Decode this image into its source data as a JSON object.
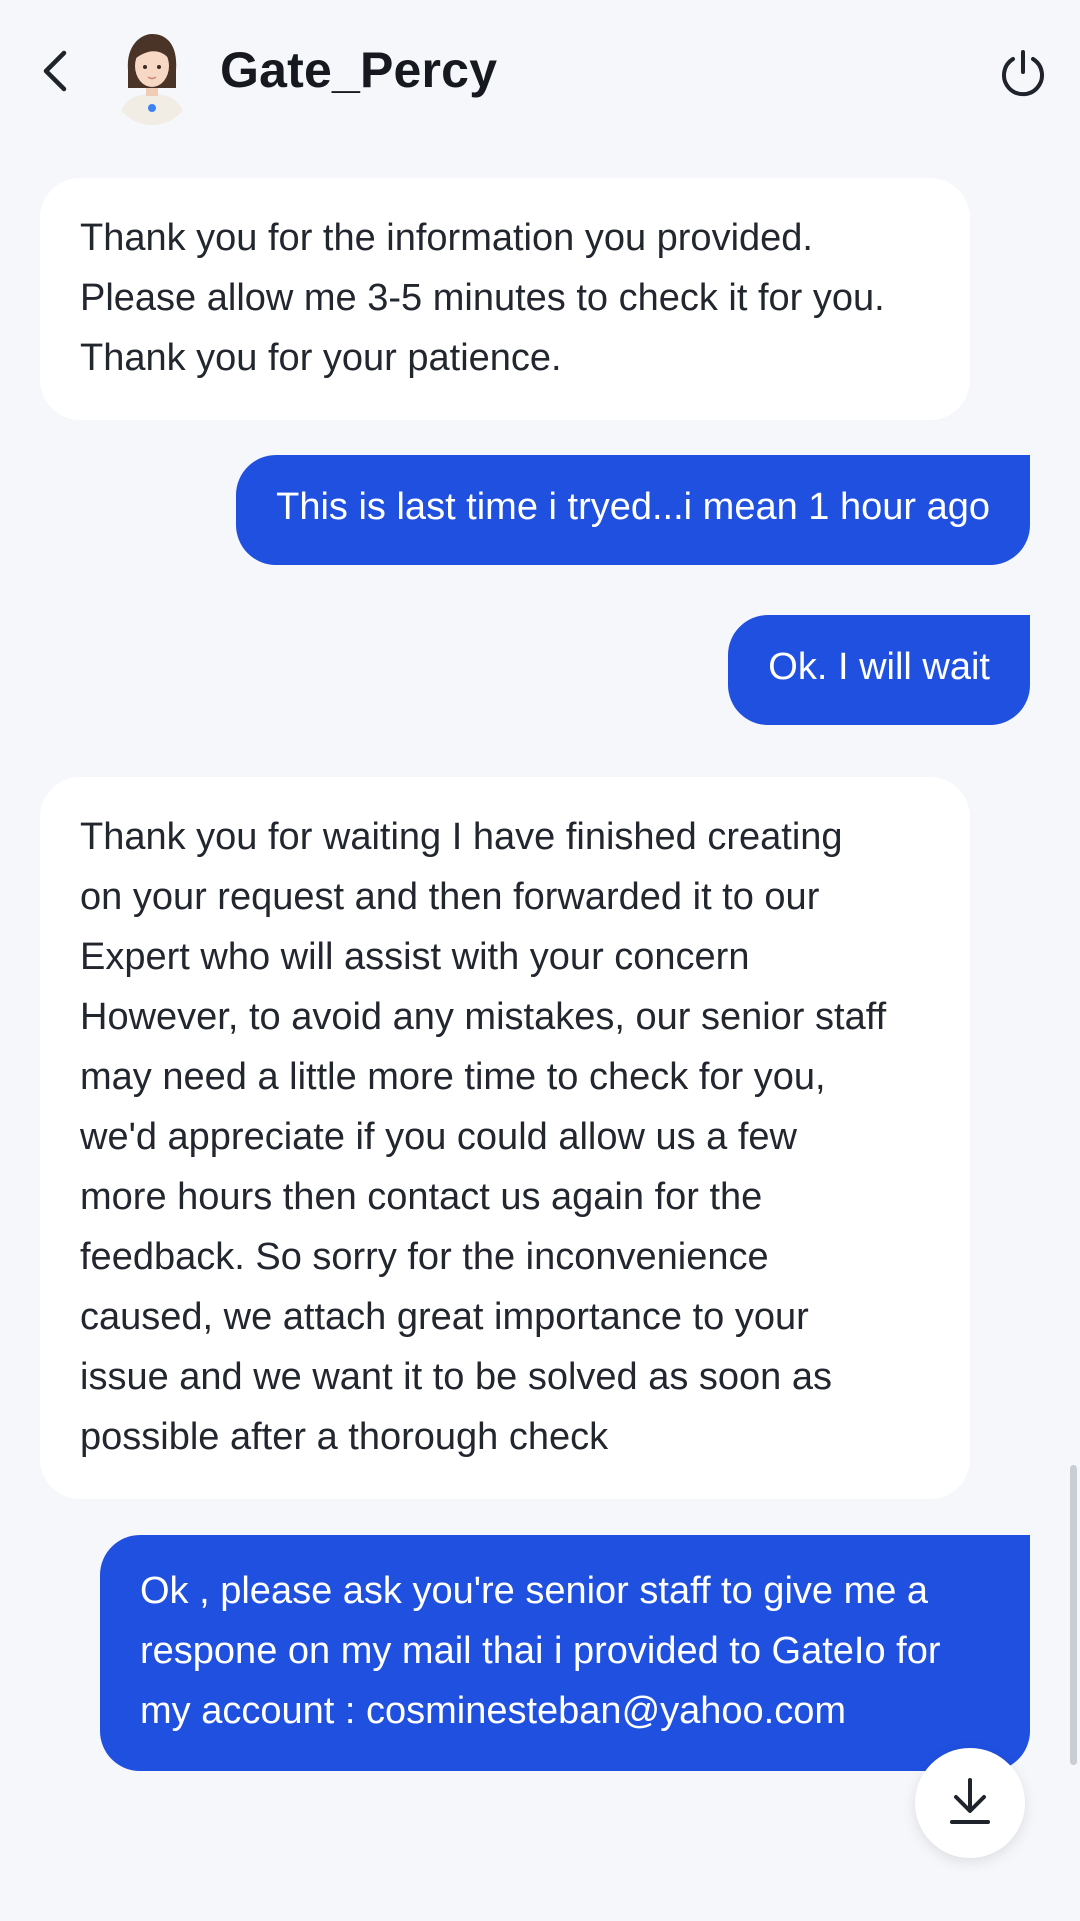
{
  "header": {
    "agent_name": "Gate_Percy",
    "back_icon": "chevron-left-icon",
    "power_icon": "power-icon"
  },
  "messages": [
    {
      "sender": "agent",
      "lines": [
        "Thank you for the information you provided.",
        "Please allow me 3-5 minutes to check it for you.",
        "Thank you for your patience."
      ]
    },
    {
      "sender": "user",
      "lines": [
        "This is last time i tryed...i mean 1 hour ago"
      ]
    },
    {
      "sender": "user",
      "lines": [
        "Ok. I will wait"
      ]
    },
    {
      "sender": "agent",
      "lines": [
        "Thank you for waiting I have finished creating",
        "on your request and then forwarded it to our",
        "Expert who will assist with your concern",
        "However, to avoid any mistakes, our senior staff",
        "may need a little more time to check for you,",
        "we'd appreciate if you could allow us a few",
        "more hours then contact us again for the",
        "feedback. So sorry for the inconvenience",
        "caused, we attach great importance to your",
        "issue and we want it to be solved as soon as",
        "possible after a thorough check"
      ]
    },
    {
      "sender": "user",
      "lines": [
        "Ok , please ask you're senior staff to give me a",
        "respone on my mail thai i provided to GateIo for",
        "my account : cosminesteban@yahoo.com"
      ]
    }
  ],
  "download_icon": "download-arrow-icon",
  "colors": {
    "background": "#f5f7fb",
    "user_bubble": "#2050e0",
    "agent_bubble": "#ffffff",
    "text_dark": "#22262e"
  }
}
